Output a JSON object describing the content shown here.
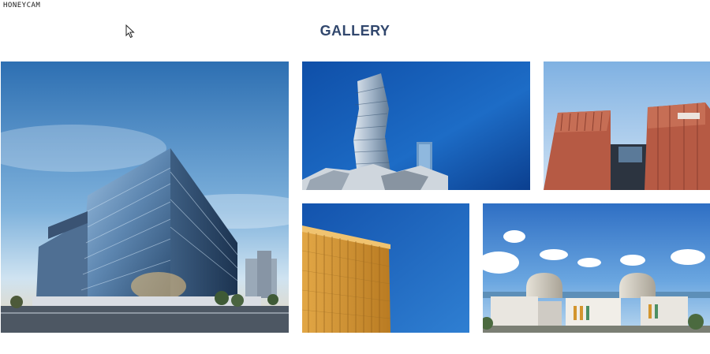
{
  "watermark": {
    "text": "HONEYCAM"
  },
  "gallery": {
    "title": "GALLERY",
    "images": [
      {
        "name": "Glass office complex at dusk"
      },
      {
        "name": "Twisted glass tower"
      },
      {
        "name": "Red brick twin buildings"
      },
      {
        "name": "Orange facade building"
      },
      {
        "name": "Nuclear power plant domes"
      }
    ]
  },
  "colors": {
    "title": "#31476d",
    "sky_blue": "#1f6fc0",
    "brick": "#b65a44",
    "gold": "#d3952e"
  }
}
